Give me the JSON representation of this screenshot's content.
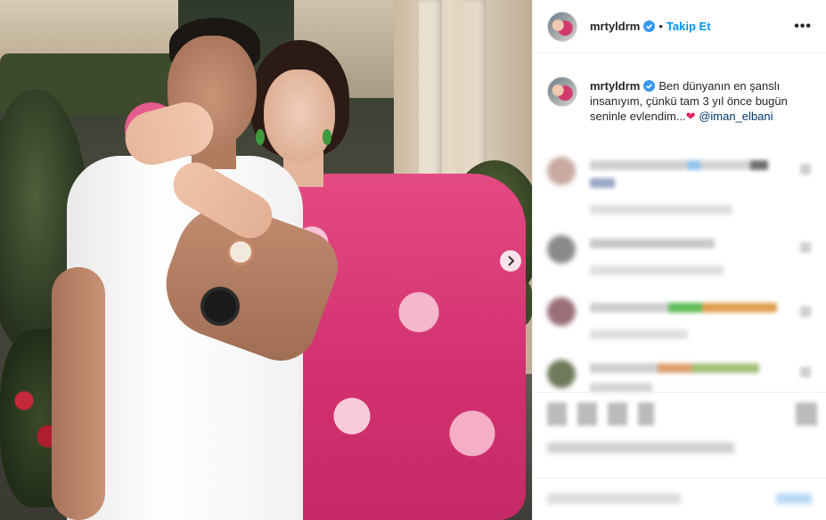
{
  "post": {
    "username": "mrtyldrm",
    "follow_label": "Takip Et",
    "more_label": "•••",
    "caption_username": "mrtyldrm",
    "caption_text": "Ben dünyanın en şanslı insanıyım, çünkü tam 3 yıl önce bugün seninle evlendim...",
    "caption_heart": "❤",
    "caption_mention": "@iman_elbani",
    "dot": "•"
  },
  "icons": {
    "verified": "verified-badge-icon",
    "next": "chevron-right-icon",
    "more": "more-options-icon"
  },
  "colors": {
    "accent": "#0095f6",
    "verified": "#3897f0",
    "mention": "#00376b",
    "heart": "#e0245e"
  }
}
